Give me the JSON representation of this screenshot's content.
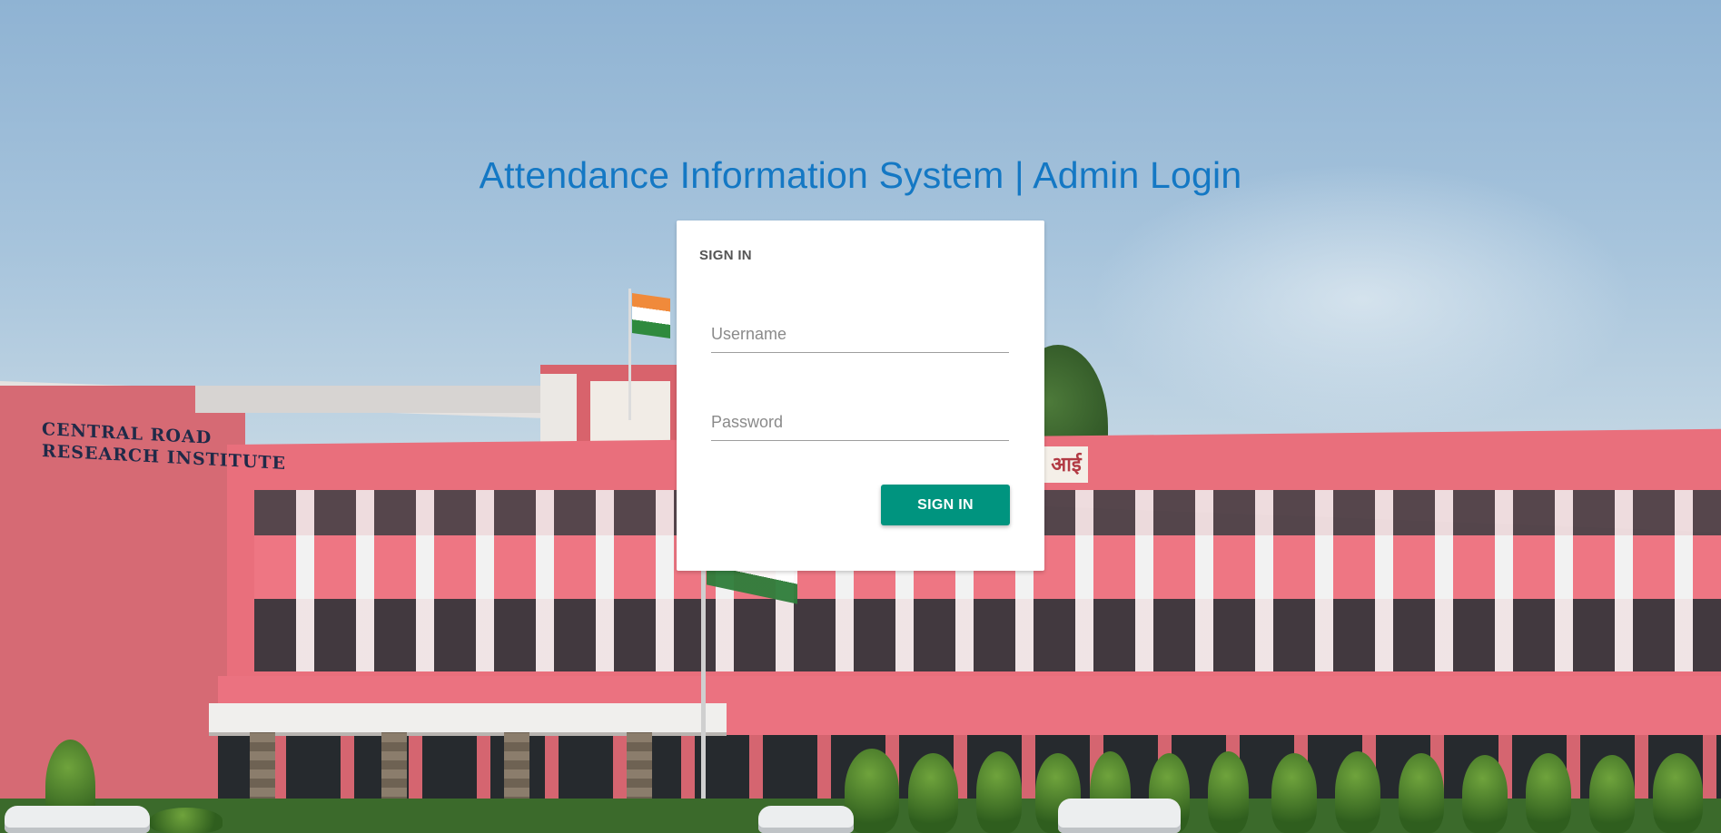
{
  "page": {
    "title": "Attendance Information System | Admin Login"
  },
  "login_card": {
    "header": "SIGN IN",
    "username": {
      "placeholder": "Username",
      "value": ""
    },
    "password": {
      "placeholder": "Password",
      "value": ""
    },
    "submit_label": "SIGN IN"
  },
  "background": {
    "sign_line1": "CENTRAL ROAD",
    "sign_line2": "RESEARCH INSTITUTE",
    "hindi_sign": "आई"
  },
  "colors": {
    "title": "#1478c4",
    "button": "#00947f",
    "card": "#ffffff"
  }
}
